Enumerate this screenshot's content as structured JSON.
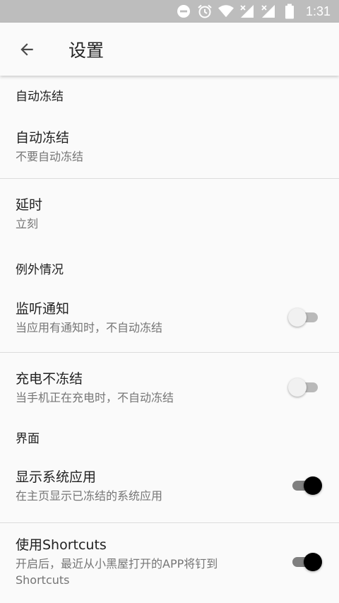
{
  "status_bar": {
    "time": "1:31",
    "icons": [
      "do-not-disturb-icon",
      "alarm-icon",
      "wifi-icon",
      "signal-icon",
      "signal-icon",
      "battery-icon"
    ]
  },
  "app_bar": {
    "title": "设置",
    "back_icon": "arrow-back-icon"
  },
  "sections": {
    "auto_freeze": {
      "header": "自动冻结",
      "items": [
        {
          "title": "自动冻结",
          "summary": "不要自动冻结"
        },
        {
          "title": "延时",
          "summary": "立刻"
        }
      ]
    },
    "exceptions": {
      "header": "例外情况",
      "items": [
        {
          "title": "监听通知",
          "summary": "当应用有通知时，不自动冻结",
          "checked": false
        },
        {
          "title": "充电不冻结",
          "summary": "当手机正在充电时，不自动冻结",
          "checked": false
        }
      ]
    },
    "interface": {
      "header": "界面",
      "items": [
        {
          "title": "显示系统应用",
          "summary": "在主页显示已冻结的系统应用",
          "checked": true
        },
        {
          "title": "使用Shortcuts",
          "summary": "开启后，最近从小黑屋打开的APP将钉到Shortcuts",
          "checked": true
        }
      ]
    }
  },
  "colors": {
    "status_bar_bg": "#bdbdbd",
    "background": "#fafafa",
    "switch_on_thumb": "#000000",
    "switch_off_thumb": "#f1f1f1"
  }
}
